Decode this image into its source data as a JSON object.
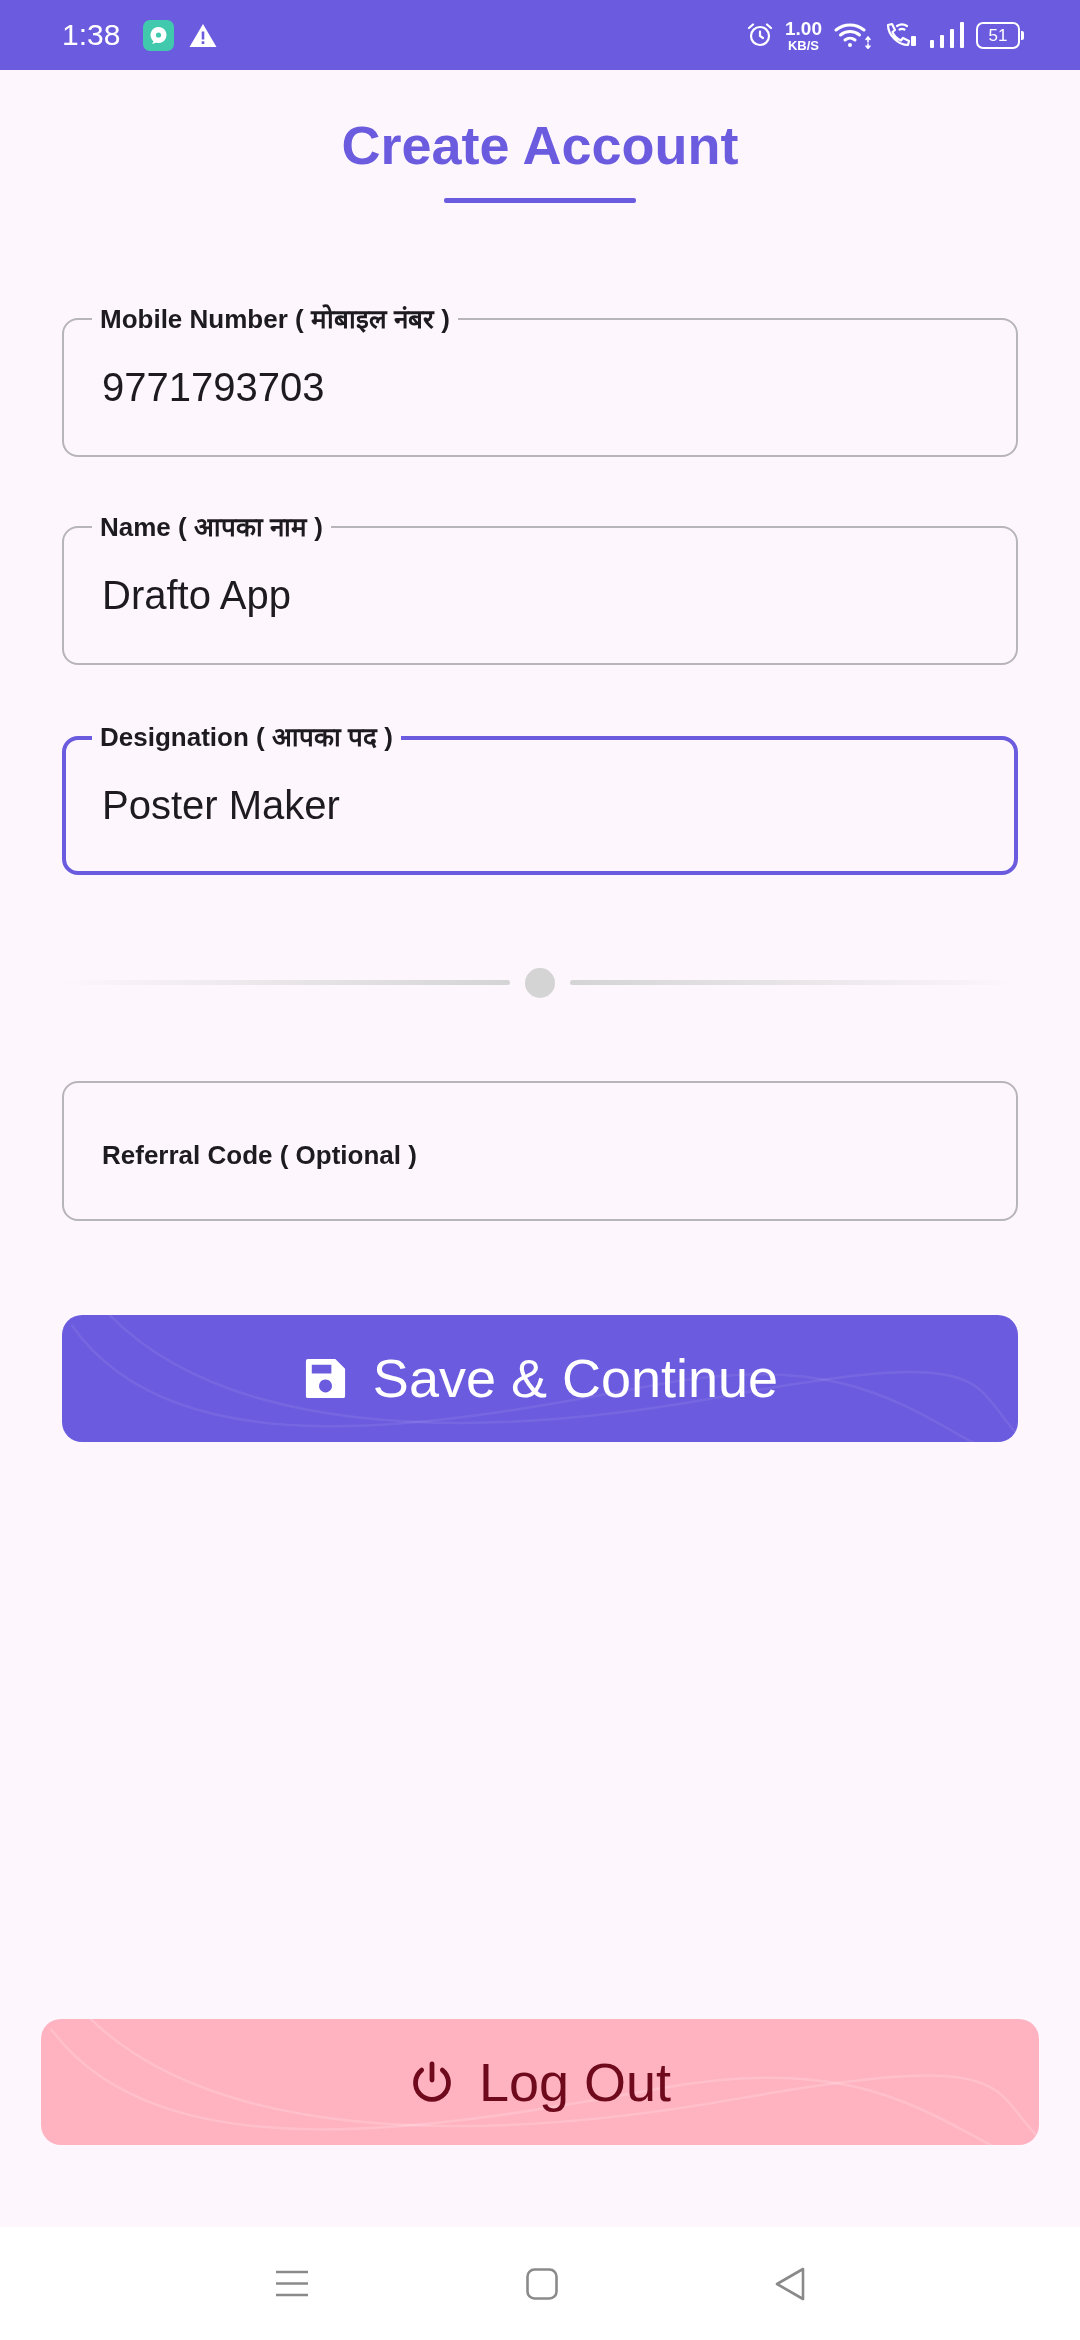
{
  "status_bar": {
    "time": "1:38",
    "network_speed": "1.00",
    "network_speed_unit": "KB/S",
    "battery": "51"
  },
  "header": {
    "title": "Create Account"
  },
  "fields": [
    {
      "label": "Mobile Number ( मोबाइल नंबर )",
      "value": "9771793703",
      "focused": false
    },
    {
      "label": "Name ( आपका नाम )",
      "value": "Drafto App",
      "focused": false
    },
    {
      "label": "Designation ( आपका पद )",
      "value": "Poster Maker",
      "focused": true
    }
  ],
  "referral_field": {
    "placeholder": "Referral Code ( Optional )"
  },
  "save_button": {
    "label": "Save & Continue"
  },
  "logout_button": {
    "label": "Log Out"
  }
}
